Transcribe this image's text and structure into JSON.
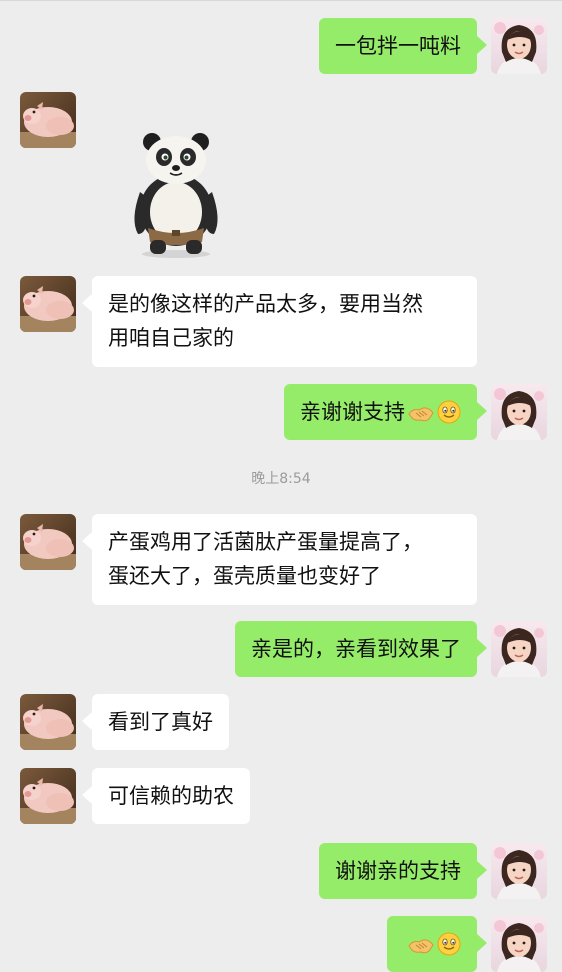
{
  "messages": [
    {
      "id": "m1",
      "side": "out",
      "text": "一包拌一吨料"
    },
    {
      "id": "m2",
      "side": "in",
      "type": "sticker",
      "sticker": "panda-sticker"
    },
    {
      "id": "m3",
      "side": "in",
      "lines": [
        "是的像这样的产品太多，要用当然",
        "用咱自己家的"
      ]
    },
    {
      "id": "m4",
      "side": "out",
      "text": "亲谢谢支持",
      "emojis": [
        "handshake-emoji",
        "smile-emoji"
      ]
    },
    {
      "id": "m5",
      "side": "in",
      "lines": [
        "产蛋鸡用了活菌肽产蛋量提高了，",
        "蛋还大了，蛋壳质量也变好了"
      ]
    },
    {
      "id": "m6",
      "side": "out",
      "text": "亲是的，亲看到效果了"
    },
    {
      "id": "m7",
      "side": "in",
      "text": "看到了真好"
    },
    {
      "id": "m8",
      "side": "in",
      "text": "可信赖的助农"
    },
    {
      "id": "m9",
      "side": "out",
      "text": "谢谢亲的支持"
    },
    {
      "id": "m10",
      "side": "out",
      "text": "",
      "emojis": [
        "handshake-emoji",
        "smile-emoji"
      ]
    }
  ],
  "timestamp": "晚上8:54",
  "colors": {
    "background": "#ededed",
    "incoming_bubble": "#ffffff",
    "outgoing_bubble": "#95ec69",
    "timestamp_text": "#9b9b9b"
  },
  "avatars": {
    "contact": "pig-avatar",
    "self": "woman-avatar"
  }
}
